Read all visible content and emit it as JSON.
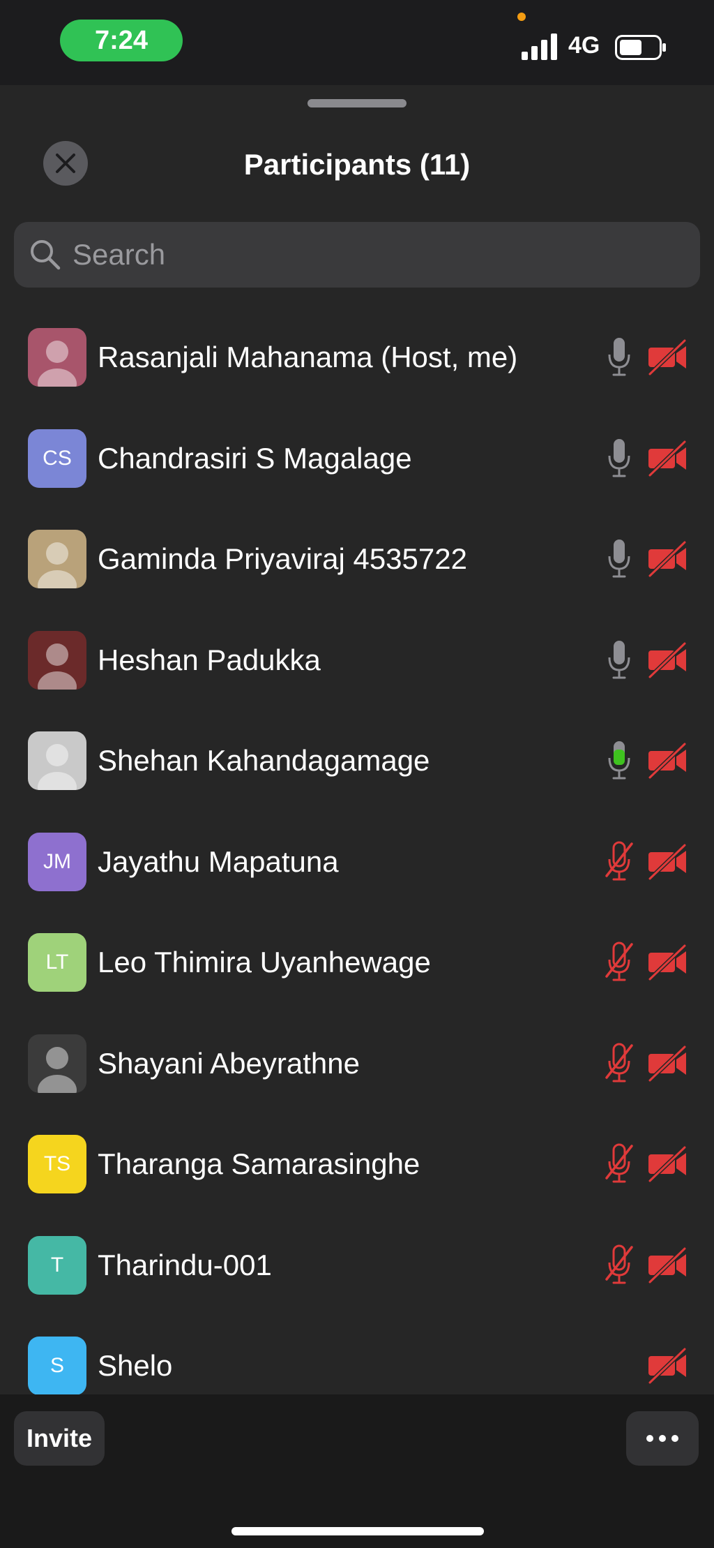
{
  "status_bar": {
    "time": "7:24",
    "network": "4G",
    "time_pill_color": "#30c255",
    "privacy_dot_color": "#f39c12",
    "signal_bars": 4,
    "battery_level": 0.6
  },
  "header": {
    "title": "Participants (11)",
    "close_icon": "close-icon"
  },
  "search": {
    "placeholder": "Search",
    "value": ""
  },
  "colors": {
    "muted_red": "#e03a3a",
    "mic_gray": "#8e8e93",
    "mic_active_green": "#3fc21f"
  },
  "participants": [
    {
      "name": "Rasanjali Mahanama (Host, me)",
      "avatar": "photo",
      "avatar_color": "#a8556b",
      "initials": "",
      "mic": "on",
      "video": "off"
    },
    {
      "name": "Chandrasiri S Magalage",
      "avatar": "initials",
      "avatar_color": "#7b86d6",
      "initials": "CS",
      "mic": "on",
      "video": "off"
    },
    {
      "name": "Gaminda Priyaviraj 4535722",
      "avatar": "photo",
      "avatar_color": "#b9a27a",
      "initials": "",
      "mic": "on",
      "video": "off"
    },
    {
      "name": "Heshan Padukka",
      "avatar": "photo",
      "avatar_color": "#6b2a2a",
      "initials": "",
      "mic": "on",
      "video": "off"
    },
    {
      "name": "Shehan Kahandagamage",
      "avatar": "photo",
      "avatar_color": "#c9c9c9",
      "initials": "",
      "mic": "speaking",
      "video": "off"
    },
    {
      "name": "Jayathu Mapatuna",
      "avatar": "initials",
      "avatar_color": "#8e70cf",
      "initials": "JM",
      "mic": "muted",
      "video": "off"
    },
    {
      "name": "Leo Thimira Uyanhewage",
      "avatar": "initials",
      "avatar_color": "#9fd27a",
      "initials": "LT",
      "mic": "muted",
      "video": "off"
    },
    {
      "name": "Shayani Abeyrathne",
      "avatar": "photo",
      "avatar_color": "#3b3b3b",
      "initials": "",
      "mic": "muted",
      "video": "off"
    },
    {
      "name": "Tharanga Samarasinghe",
      "avatar": "initials",
      "avatar_color": "#f5d51e",
      "initials": "TS",
      "mic": "muted",
      "video": "off"
    },
    {
      "name": "Tharindu-001",
      "avatar": "initials",
      "avatar_color": "#45b8a5",
      "initials": "T",
      "mic": "muted",
      "video": "off"
    },
    {
      "name": "Shelo",
      "avatar": "initials",
      "avatar_color": "#3eb6f2",
      "initials": "S",
      "mic": "none",
      "video": "off"
    }
  ],
  "footer": {
    "invite_label": "Invite",
    "more_icon": "more-icon"
  }
}
